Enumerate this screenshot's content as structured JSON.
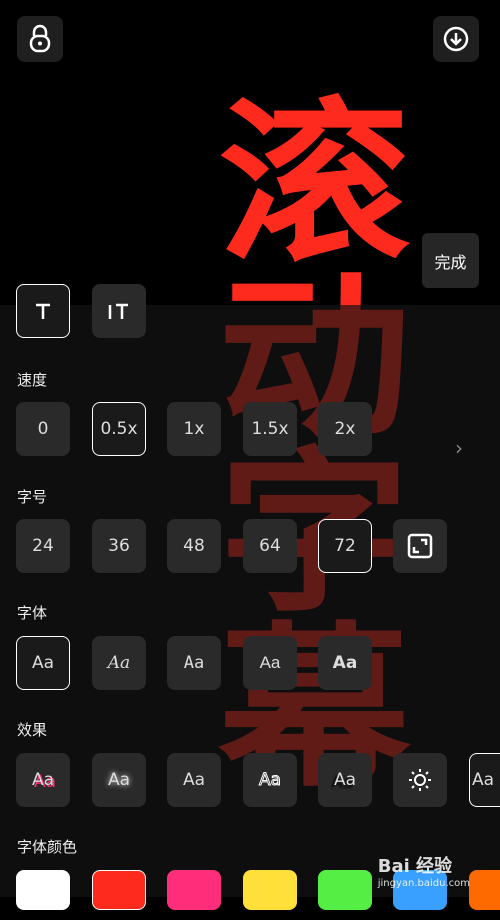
{
  "preview": {
    "text": "滚动字幕"
  },
  "toolbar": {
    "done_label": "完成"
  },
  "speed": {
    "label": "速度",
    "options": [
      "0",
      "0.5x",
      "1x",
      "1.5x",
      "2x"
    ]
  },
  "size": {
    "label": "字号",
    "options": [
      "24",
      "36",
      "48",
      "64",
      "72"
    ]
  },
  "font": {
    "label": "字体",
    "sample": "Aa"
  },
  "effect": {
    "label": "效果",
    "sample": "Aa"
  },
  "color": {
    "label": "字体颜色",
    "swatches": [
      "#ffffff",
      "#ff2a1e",
      "#ff2d7a",
      "#ffe03a",
      "#55ee44",
      "#3aa0ff",
      "#ff6a00"
    ]
  },
  "watermark": {
    "text": "Bai 经验",
    "sub": "jingyan.baidu.com"
  }
}
